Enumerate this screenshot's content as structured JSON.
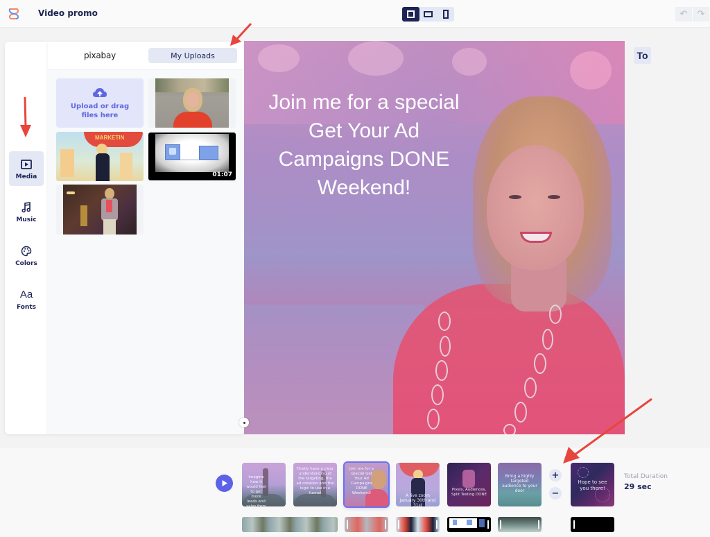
{
  "header": {
    "project_title": "Video promo",
    "ratio_options": [
      {
        "name": "square",
        "active": true
      },
      {
        "name": "landscape",
        "active": false
      },
      {
        "name": "portrait",
        "active": false
      }
    ],
    "undo_label": "↶",
    "redo_label": "↷"
  },
  "sidebar": {
    "items": [
      {
        "label": "Media",
        "icon": "media-icon",
        "active": true
      },
      {
        "label": "Music",
        "icon": "music-icon",
        "active": false
      },
      {
        "label": "Colors",
        "icon": "palette-icon",
        "active": false
      },
      {
        "label": "Fonts",
        "icon": "fonts-icon",
        "glyph": "Aa",
        "active": false
      }
    ]
  },
  "media_panel": {
    "tabs": [
      {
        "label": "pixabay",
        "active": false
      },
      {
        "label": "My Uploads",
        "active": true
      }
    ],
    "upload_text_line1": "Upload or drag",
    "upload_text_line2": "files here",
    "items": [
      {
        "kind": "image",
        "description": "woman in red top on street"
      },
      {
        "kind": "image",
        "description": "woman on stage at Social Media Marketing World"
      },
      {
        "kind": "video",
        "description": "facebook like animation",
        "duration": "01:07"
      },
      {
        "kind": "image",
        "description": "woman speaking with microphone"
      }
    ]
  },
  "canvas": {
    "headline_lines": [
      "Join me for a special",
      "Get Your Ad",
      "Campaigns DONE",
      "Weekend!"
    ]
  },
  "tools": {
    "text_tool_label": "To"
  },
  "timeline": {
    "scenes": [
      {
        "text": "Imagine how it would feel to get more leads and sales from Facebook and Instagram",
        "active": false
      },
      {
        "text": "Finally have a clear understanding of the targeting, the ad creation and the logic to use in a funnel",
        "active": false
      },
      {
        "text": "Join me for a special Get Your Ad Campaigns DONE Weekend!",
        "active": true
      },
      {
        "text": "A live zoom January 30th and 31st",
        "active": false
      },
      {
        "text": "Pixels, Audiences, Split Testing DONE",
        "active": false
      },
      {
        "text": "Bring a highly targeted audience to your door",
        "active": false
      },
      {
        "text": "Hope to see you there!",
        "active": false
      }
    ],
    "zoom_in_label": "+",
    "zoom_out_label": "−",
    "total_duration_label": "Total Duration",
    "total_duration_value": "29 sec"
  },
  "colors": {
    "accent": "#5c63e6",
    "navy": "#1c2456",
    "selected_bg": "#e3e8f4",
    "annotation_arrow": "#e8453c"
  }
}
